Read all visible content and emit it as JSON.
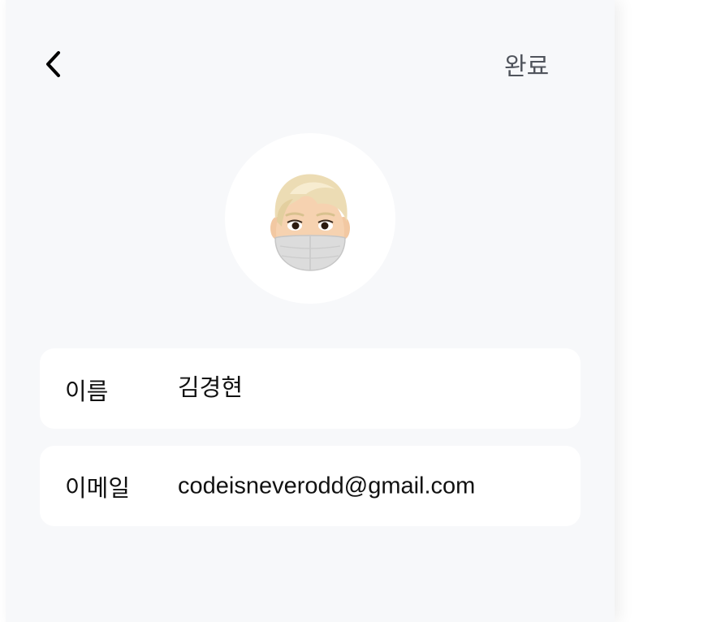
{
  "header": {
    "back_icon": "chevron-left-icon",
    "done_label": "완료"
  },
  "profile": {
    "avatar_icon": "memoji-avatar-with-mask"
  },
  "fields": {
    "name": {
      "label": "이름",
      "value": "김경현"
    },
    "email": {
      "label": "이메일",
      "value": "codeisneverodd@gmail.com"
    }
  },
  "colors": {
    "panel_bg": "#f7f8fa",
    "card_bg": "#ffffff",
    "done_text": "#50545c"
  }
}
